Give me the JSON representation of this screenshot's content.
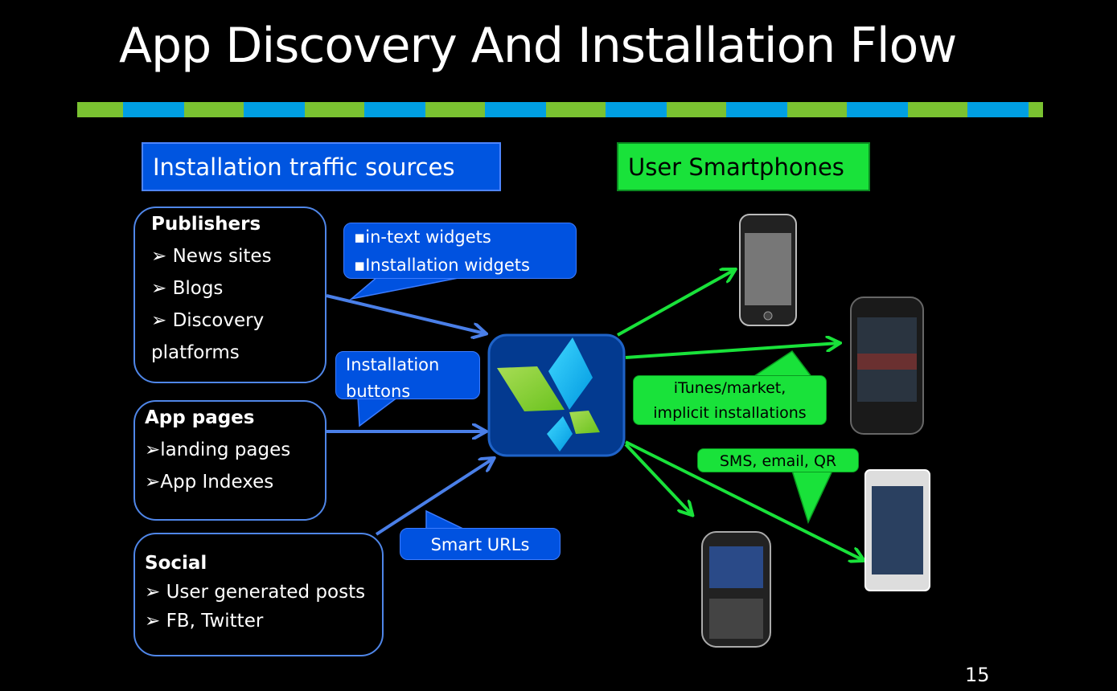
{
  "title": "App Discovery And Installation Flow",
  "headers": {
    "left": "Installation traffic sources",
    "right": "User Smartphones"
  },
  "sources": {
    "publishers": {
      "title": "Publishers",
      "items": [
        "➢ News sites",
        "➢ Blogs",
        "➢ Discovery",
        "platforms"
      ]
    },
    "app_pages": {
      "title": "App pages",
      "items": [
        "➢landing pages",
        "➢App Indexes"
      ]
    },
    "social": {
      "title": "Social",
      "items": [
        "➢ User generated posts",
        "➢ FB, Twitter"
      ]
    }
  },
  "callouts": {
    "widgets": [
      "▪in-text widgets",
      "▪Installation widgets"
    ],
    "buttons": [
      "Installation",
      "buttons"
    ],
    "smart_urls": "Smart URLs",
    "itunes": [
      "iTunes/market,",
      "implicit installations"
    ],
    "sms": "SMS, email, QR"
  },
  "devices": [
    "iphone",
    "android-nexus",
    "nokia",
    "blackberry"
  ],
  "colors": {
    "blue": "#0055e0",
    "green": "#19e23a",
    "arrow_blue": "#4a7fe8",
    "arrow_green": "#19e23a"
  },
  "page_number": "15"
}
